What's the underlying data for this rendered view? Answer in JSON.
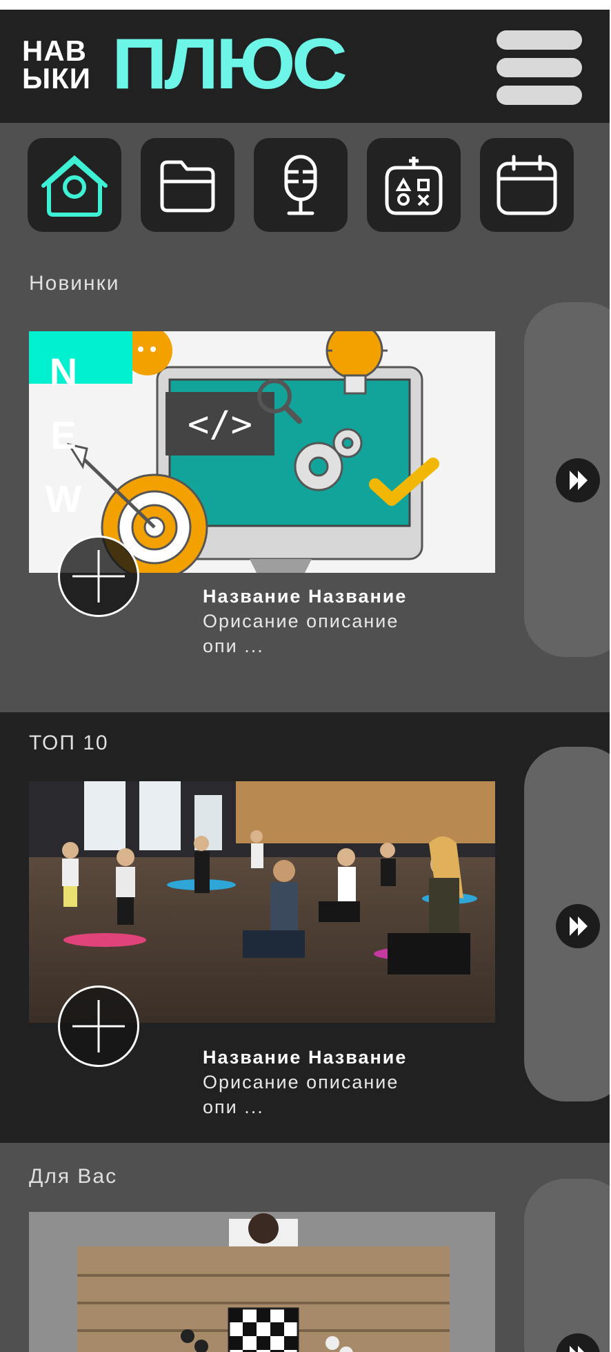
{
  "header": {
    "logo_small_line1": "НАВ",
    "logo_small_line2": "ЫКИ",
    "logo_big": "ПЛЮС",
    "menu_icon": "hamburger-menu-icon"
  },
  "categories": [
    {
      "name": "home",
      "icon": "home-icon",
      "active": true
    },
    {
      "name": "folder",
      "icon": "folder-icon",
      "active": false
    },
    {
      "name": "podcast",
      "icon": "microphone-icon",
      "active": false
    },
    {
      "name": "games",
      "icon": "gamepad-icon",
      "active": false
    },
    {
      "name": "calendar",
      "icon": "calendar-icon",
      "active": false
    }
  ],
  "sections": [
    {
      "title": "Новинки",
      "badge": "NEW",
      "card": {
        "title": "Название Название",
        "desc_line1": "Орисание описание",
        "desc_line2": "опи ..."
      }
    },
    {
      "title": "ТОП 10",
      "card": {
        "title": "Название Название",
        "desc_line1": "Орисание описание",
        "desc_line2": "опи ..."
      }
    },
    {
      "title": "Для Вас"
    }
  ],
  "colors": {
    "accent": "#6df5e8",
    "badge": "#00f0d0",
    "header_bg": "#212121",
    "page_bg": "#505050"
  }
}
